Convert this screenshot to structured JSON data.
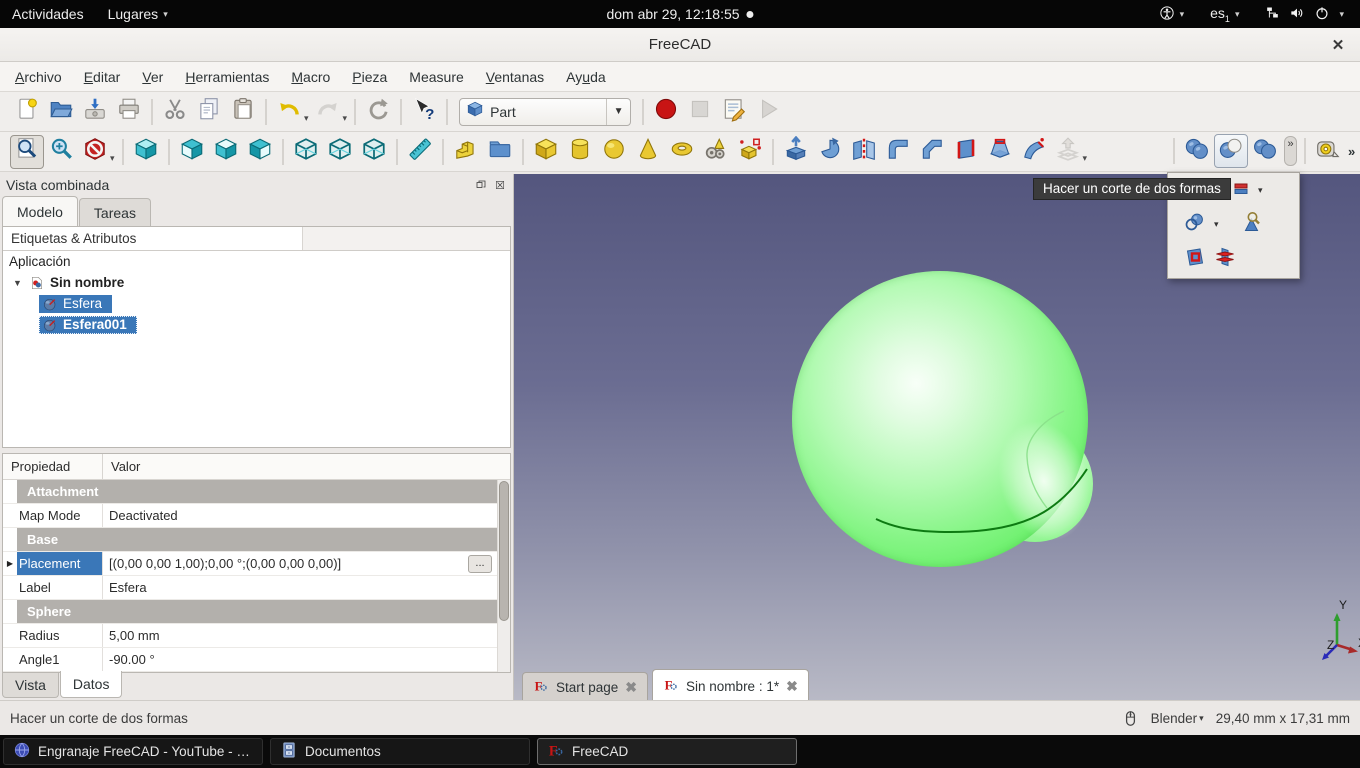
{
  "desktop": {
    "top_bar": {
      "activities": "Actividades",
      "places": "Lugares",
      "clock": "dom abr 29, 12:18:55",
      "keyboard_layout": "es",
      "keyboard_layout_sub": "1"
    },
    "taskbar": [
      {
        "label": "Engranaje FreeCAD - YouTube - Ic...",
        "icon": "browser-icon",
        "active": false
      },
      {
        "label": "Documentos",
        "icon": "file-manager-icon",
        "active": false
      },
      {
        "label": "FreeCAD",
        "icon": "freecad-icon",
        "active": true
      }
    ]
  },
  "window": {
    "title": "FreeCAD",
    "menu": [
      {
        "label": "Archivo",
        "underline": 0
      },
      {
        "label": "Editar",
        "underline": 0
      },
      {
        "label": "Ver",
        "underline": 0
      },
      {
        "label": "Herramientas",
        "underline": 0
      },
      {
        "label": "Macro",
        "underline": 0
      },
      {
        "label": "Pieza",
        "underline": 0
      },
      {
        "label": "Measure",
        "underline": -1
      },
      {
        "label": "Ventanas",
        "underline": 0
      },
      {
        "label": "Ayuda",
        "underline": 2
      }
    ],
    "workbench_selector": "Part",
    "toolbars": {
      "standard": [
        {
          "icon": "new-document"
        },
        {
          "icon": "open-document"
        },
        {
          "icon": "save-document"
        },
        {
          "icon": "print"
        },
        {
          "sep": true
        },
        {
          "icon": "cut"
        },
        {
          "icon": "copy"
        },
        {
          "icon": "paste"
        },
        {
          "sep": true
        },
        {
          "icon": "undo",
          "arrow": true
        },
        {
          "icon": "redo",
          "arrow": true,
          "disabled": true
        },
        {
          "sep": true
        },
        {
          "icon": "refresh"
        },
        {
          "sep": true
        },
        {
          "icon": "whats-this"
        },
        {
          "sep": true
        },
        {
          "combo": true
        },
        {
          "sep": true
        },
        {
          "icon": "macro-record"
        },
        {
          "icon": "macro-stop",
          "disabled": true
        },
        {
          "icon": "macro-edit"
        },
        {
          "icon": "macro-play",
          "disabled": true
        }
      ],
      "view_and_part": [
        {
          "icon": "fit-all",
          "pressed": true
        },
        {
          "icon": "zoom-box"
        },
        {
          "icon": "draw-style",
          "arrow": true
        },
        {
          "sep": true
        },
        {
          "icon": "view-axonometric"
        },
        {
          "sep": true
        },
        {
          "icon": "view-front"
        },
        {
          "icon": "view-top"
        },
        {
          "icon": "view-right"
        },
        {
          "sep": true
        },
        {
          "icon": "view-rear"
        },
        {
          "icon": "view-bottom"
        },
        {
          "icon": "view-left"
        },
        {
          "sep": true
        },
        {
          "icon": "measure-distance"
        },
        {
          "sep": true
        },
        {
          "icon": "part-workbench"
        },
        {
          "icon": "create-group"
        },
        {
          "sep": true
        },
        {
          "icon": "cube-primitive"
        },
        {
          "icon": "cylinder-primitive"
        },
        {
          "icon": "sphere-primitive"
        },
        {
          "icon": "cone-primitive"
        },
        {
          "icon": "torus-primitive"
        },
        {
          "icon": "primitives-dialog"
        },
        {
          "icon": "shape-builder"
        },
        {
          "sep": true
        },
        {
          "icon": "extrude"
        },
        {
          "icon": "revolve"
        },
        {
          "icon": "mirror"
        },
        {
          "icon": "fillet"
        },
        {
          "icon": "chamfer"
        },
        {
          "icon": "ruled-surface"
        },
        {
          "icon": "loft"
        },
        {
          "icon": "sweep"
        },
        {
          "icon": "offset",
          "arrow": true,
          "disabled": true
        }
      ],
      "boolean_cluster": [
        {
          "sep": true
        },
        {
          "icon": "boolean-union"
        },
        {
          "icon": "boolean-cut",
          "hover": true
        },
        {
          "icon": "boolean-common"
        },
        {
          "chevron": true
        },
        {
          "sep": true
        },
        {
          "icon": "tape-measure"
        },
        {
          "chevron2": true
        }
      ]
    },
    "overflow_popup": {
      "row1": [
        {
          "icon": "compound",
          "arrow": true
        }
      ],
      "row2": [
        {
          "icon": "connect",
          "arrow": true
        },
        {
          "icon": "check-geometry"
        }
      ],
      "row3": [
        {
          "icon": "section"
        },
        {
          "icon": "cross-sections"
        }
      ]
    }
  },
  "tooltip": {
    "text": "Hacer un corte de dos formas"
  },
  "dock": {
    "title": "Vista combinada",
    "tabs": [
      {
        "label": "Modelo",
        "active": true
      },
      {
        "label": "Tareas",
        "active": false
      }
    ],
    "tree_header": "Etiquetas & Atributos",
    "tree_rows": [
      {
        "label": "Aplicación",
        "icon": null,
        "level": 0
      },
      {
        "label": "Sin nombre",
        "icon": "freecad-document-icon",
        "level": 1,
        "expanded": true,
        "bold": true
      },
      {
        "label": "Esfera",
        "icon": "sphere-object-icon",
        "level": 2,
        "selected": true
      },
      {
        "label": "Esfera001",
        "icon": "sphere-object-icon",
        "level": 2,
        "selected": true,
        "bold": true,
        "focused": true
      }
    ],
    "property_grid": {
      "columns": [
        "Propiedad",
        "Valor"
      ],
      "rows": [
        {
          "type": "group",
          "name": "Attachment"
        },
        {
          "type": "row",
          "name": "Map Mode",
          "value": "Deactivated"
        },
        {
          "type": "group",
          "name": "Base"
        },
        {
          "type": "row",
          "name": "Placement",
          "value": "[(0,00 0,00 1,00);0,00 °;(0,00 0,00 0,00)]",
          "selected": true,
          "expand_arrow": true,
          "editor": "..."
        },
        {
          "type": "row",
          "name": "Label",
          "value": "Esfera"
        },
        {
          "type": "group",
          "name": "Sphere"
        },
        {
          "type": "row",
          "name": "Radius",
          "value": "5,00 mm"
        },
        {
          "type": "row",
          "name": "Angle1",
          "value": "-90.00 °"
        }
      ]
    },
    "bottom_tabs": [
      {
        "label": "Vista",
        "active": false
      },
      {
        "label": "Datos",
        "active": true
      }
    ]
  },
  "viewport": {
    "mdi_tabs": [
      {
        "label": "Start page",
        "active": false
      },
      {
        "label": "Sin nombre : 1*",
        "active": true
      }
    ],
    "axis_labels": {
      "x": "X",
      "y": "Y",
      "z": "Z"
    }
  },
  "status_bar": {
    "message": "Hacer un corte de dos formas",
    "nav_style": "Blender",
    "dimensions": "29,40 mm x 17,31 mm"
  },
  "colors": {
    "selection_blue": "#3a77b8",
    "sphere_green": "#55ea55",
    "viewport_gradient_top": "#54567e",
    "viewport_gradient_bottom": "#b9bac6",
    "record_red": "#c81414",
    "tooltip_bg": "#3b3b3b"
  }
}
